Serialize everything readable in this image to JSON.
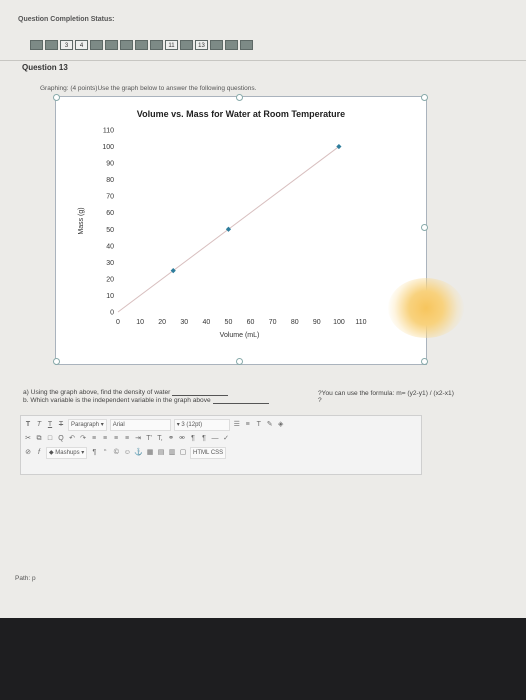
{
  "status": {
    "title": "Question Completion Status:",
    "boxes": [
      "",
      "",
      "3",
      "4",
      "",
      "",
      "",
      "",
      "",
      "11",
      "",
      "13",
      "",
      "",
      ""
    ]
  },
  "question": {
    "title": "Question 13",
    "instruction": "Graphing: (4 points)Use the graph below to answer the following questions.",
    "qa_line1": "a) Using the graph above, find the density of water",
    "qa_line2": "b. Which variable is the independent variable in the graph above",
    "hint": "?You can use the formula: m= (y2-y1) / (x2-x1)",
    "hint_q": "?"
  },
  "chart_data": {
    "type": "scatter",
    "title": "Volume vs. Mass for Water at Room Temperature",
    "xlabel": "Volume (mL)",
    "ylabel": "Mass (g)",
    "xlim": [
      0,
      110
    ],
    "ylim": [
      0,
      110
    ],
    "x_ticks": [
      0,
      10,
      20,
      30,
      40,
      50,
      60,
      70,
      80,
      90,
      100,
      110
    ],
    "y_ticks": [
      0,
      10,
      20,
      30,
      40,
      50,
      60,
      70,
      80,
      90,
      100,
      110
    ],
    "points": [
      {
        "x": 25,
        "y": 25
      },
      {
        "x": 50,
        "y": 50
      },
      {
        "x": 100,
        "y": 100
      }
    ],
    "trendline": [
      [
        0,
        0
      ],
      [
        100,
        100
      ]
    ],
    "point_color": "#2e7d9c",
    "line_color": "#d8bfbf"
  },
  "editor": {
    "format_block": "Paragraph",
    "font_family": "Arial",
    "font_size": "3 (12pt)",
    "mashups": "Mashups",
    "html_css": "HTML CSS"
  },
  "path": "Path: p"
}
